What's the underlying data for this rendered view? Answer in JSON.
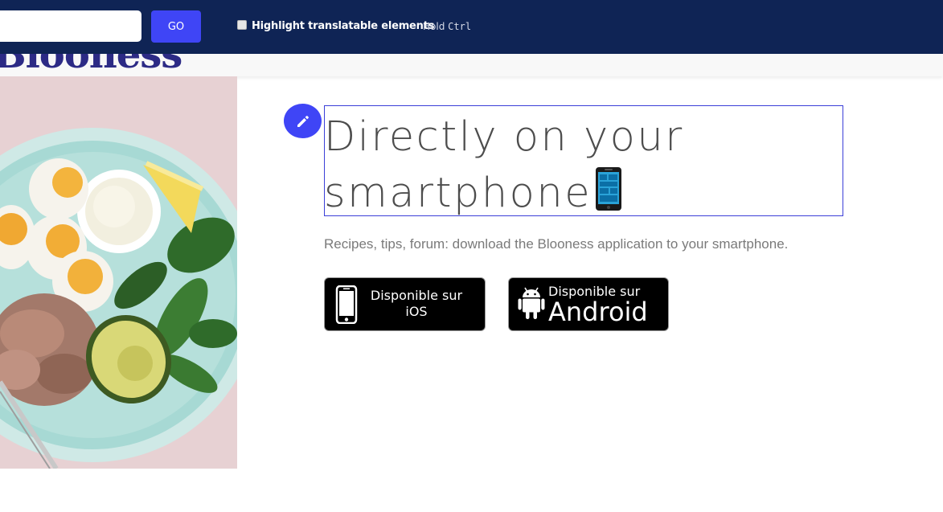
{
  "toolbar": {
    "url_value": "",
    "go_label": "GO",
    "highlight_label": "Highlight translatable elements",
    "hint_prefix": "Hold",
    "hint_key": "Ctrl"
  },
  "header": {
    "logo_text": "Blooness"
  },
  "hero": {
    "image_icon": "food-plate-photo",
    "edit_icon": "pencil-icon",
    "heading": "Directly on your smartphone",
    "heading_emoji": "mobile-phone-emoji",
    "subtitle": "Recipes, tips, forum: download the Blooness application to your smartphone.",
    "ios_badge": {
      "line1": "Disponible sur",
      "line2": "iOS",
      "icon": "iphone-icon"
    },
    "android_badge": {
      "line1": "Disponible sur",
      "line2": "Android",
      "icon": "android-icon"
    }
  },
  "colors": {
    "topbar_bg": "#0f2455",
    "accent": "#3f45f6",
    "logo": "#2c2a85",
    "heading": "#4d4d4d",
    "subtitle": "#7a7a7a"
  }
}
